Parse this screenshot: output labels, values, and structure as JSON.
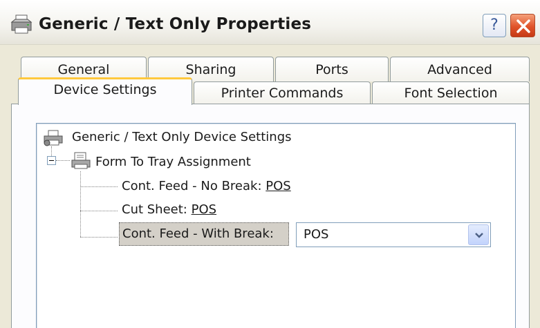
{
  "window": {
    "title": "Generic / Text Only Properties",
    "help_label": "?"
  },
  "tabs_row1": [
    "General",
    "Sharing",
    "Ports",
    "Advanced"
  ],
  "tabs_row2": [
    "Device Settings",
    "Printer Commands",
    "Font Selection"
  ],
  "active_tab": "Device Settings",
  "tree": {
    "root_label": "Generic / Text Only Device Settings",
    "group_label": "Form To Tray Assignment",
    "items": [
      {
        "label": "Cont. Feed - No Break:",
        "value": "POS"
      },
      {
        "label": "Cut Sheet:",
        "value": "POS"
      },
      {
        "label": "Cont. Feed - With Break:",
        "value": "POS"
      }
    ]
  },
  "colors": {
    "active_tab_accent": "#ffc83c",
    "close_button": "#e0532a",
    "border_blue": "#7f9db9"
  }
}
